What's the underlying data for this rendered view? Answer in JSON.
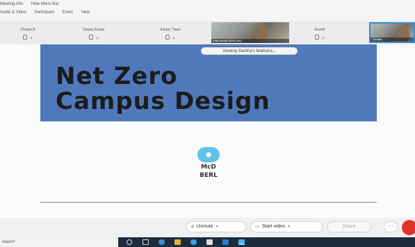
{
  "menu": {
    "row1": [
      "Meeting Info",
      "Hide Menu Bar"
    ],
    "row2": [
      "Audio & Video",
      "Participant",
      "Event",
      "Help"
    ]
  },
  "participants": [
    {
      "name": "Chetan B"
    },
    {
      "name": "Sanjay Kumar"
    },
    {
      "name": "Sanjay Tiwari"
    },
    {
      "name": "Hari Kumar"
    },
    {
      "name": "Ananth"
    },
    {
      "name": "Savitha"
    }
  ],
  "video_tiles": [
    {
      "caption": "Hari Kumar (Host, me)"
    },
    {
      "caption": "Savitha"
    }
  ],
  "share": {
    "viewing_label": "Viewing Savitha's Malhotra...",
    "slide_title_line1": "Net Zero",
    "slide_title_line2": "Campus Design",
    "logo_line1": "McD",
    "logo_line2": "BERL"
  },
  "toolbar": {
    "unmute_label": "Unmute",
    "start_video_label": "Start video",
    "share_label": "Share"
  },
  "taskbar": {
    "search_placeholder": "search"
  },
  "colors": {
    "slide_banner": "#4f79bb",
    "end_call": "#e0332a",
    "logo_accent": "#5ec3e6"
  }
}
